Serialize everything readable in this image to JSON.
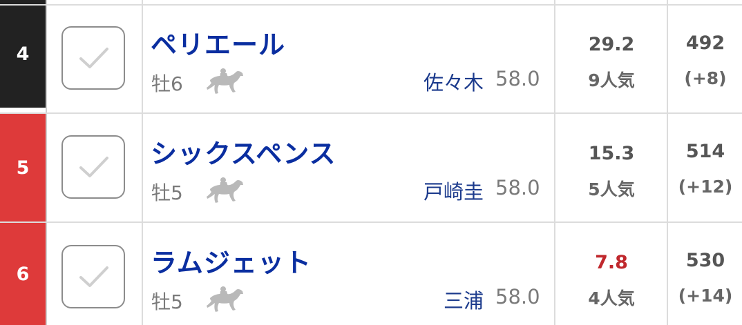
{
  "colors": {
    "waku_4": "#222222",
    "waku_5": "#de3a3a",
    "waku_6": "#de3a3a",
    "horse_name": "#0a2ea0",
    "jockey": "#1b3a8c",
    "odds_normal": "#555555",
    "odds_favorite": "#c0282d",
    "muted": "#7a7a7a",
    "horse_icon": "#b9b9b9",
    "check_mark": "#cfcfcf"
  },
  "rows": [
    {
      "waku": "4",
      "checked": false,
      "horse_name": "ペリエール",
      "sex_age": "牡6",
      "horse_icon": "racehorse-icon",
      "jockey": "佐々木",
      "weight": "58.0",
      "odds": "29.2",
      "popularity": "9人気",
      "body_weight": "492",
      "body_weight_diff": "(+8)"
    },
    {
      "waku": "5",
      "checked": false,
      "horse_name": "シックスペンス",
      "sex_age": "牡5",
      "horse_icon": "racehorse-icon",
      "jockey": "戸崎圭",
      "weight": "58.0",
      "odds": "15.3",
      "popularity": "5人気",
      "body_weight": "514",
      "body_weight_diff": "(+12)"
    },
    {
      "waku": "6",
      "checked": false,
      "horse_name": "ラムジェット",
      "sex_age": "牡5",
      "horse_icon": "racehorse-icon",
      "jockey": "三浦",
      "weight": "58.0",
      "odds": "7.8",
      "popularity": "4人気",
      "body_weight": "530",
      "body_weight_diff": "(+14)"
    }
  ]
}
